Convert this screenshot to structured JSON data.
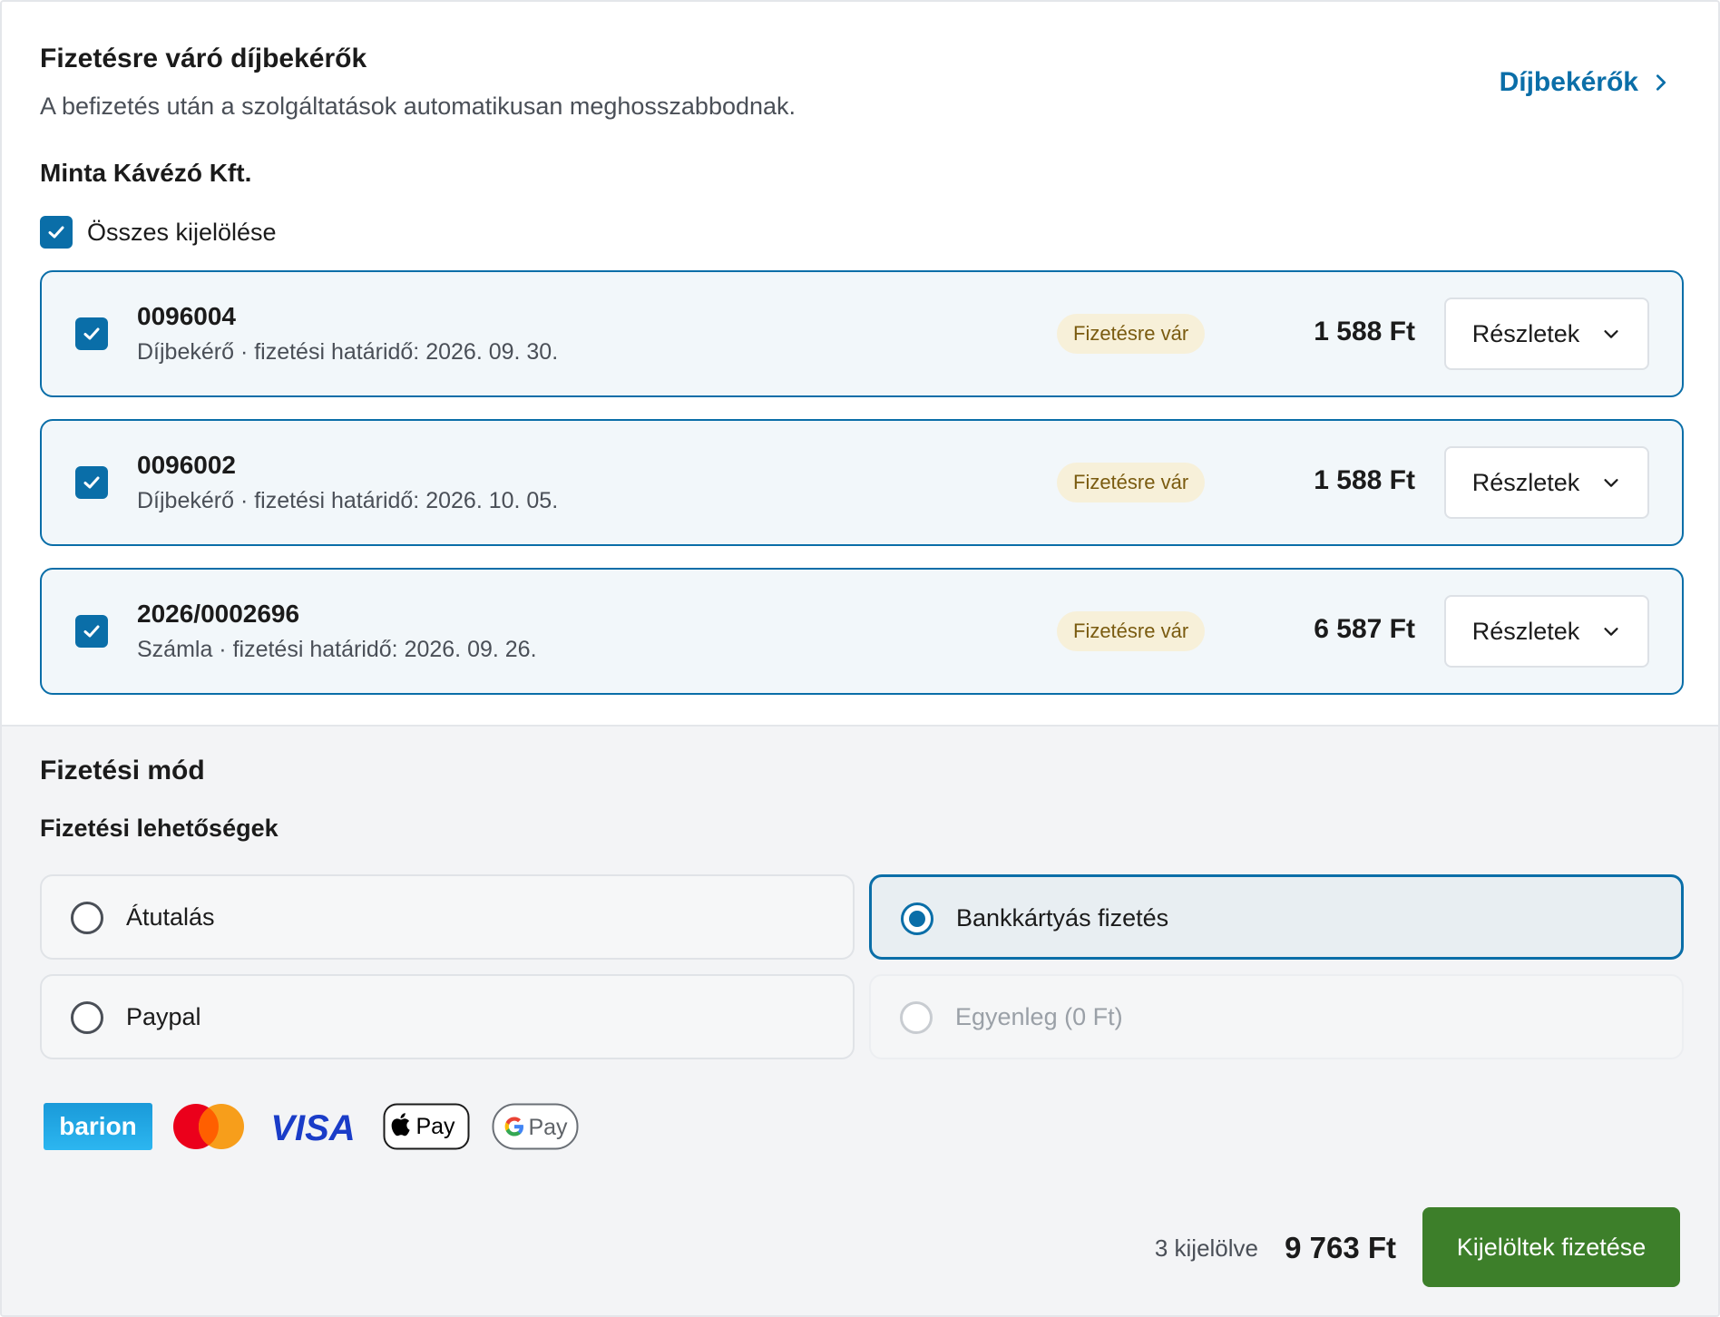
{
  "header": {
    "title": "Fizetésre váró díjbekérők",
    "subtitle": "A befizetés után a szolgáltatások automatikusan meghosszabbodnak.",
    "link_label": "Díjbekérők"
  },
  "company": "Minta Kávézó Kft.",
  "select_all": {
    "label": "Összes kijelölése",
    "checked": true
  },
  "items": [
    {
      "id": "0096004",
      "desc": "Díjbekérő · fizetési határidő: 2026. 09. 30.",
      "status": "Fizetésre vár",
      "amount": "1 588 Ft",
      "details_label": "Részletek",
      "checked": true
    },
    {
      "id": "0096002",
      "desc": "Díjbekérő · fizetési határidő: 2026. 10. 05.",
      "status": "Fizetésre vár",
      "amount": "1 588 Ft",
      "details_label": "Részletek",
      "checked": true
    },
    {
      "id": "2026/0002696",
      "desc": "Számla · fizetési határidő: 2026. 09. 26.",
      "status": "Fizetésre vár",
      "amount": "6 587 Ft",
      "details_label": "Részletek",
      "checked": true
    }
  ],
  "payment": {
    "title": "Fizetési mód",
    "subtitle": "Fizetési lehetőségek",
    "options": [
      {
        "label": "Átutalás",
        "selected": false,
        "disabled": false
      },
      {
        "label": "Bankkártyás fizetés",
        "selected": true,
        "disabled": false
      },
      {
        "label": "Paypal",
        "selected": false,
        "disabled": false
      },
      {
        "label": "Egyenleg (0 Ft)",
        "selected": false,
        "disabled": true
      }
    ],
    "logos": {
      "barion": "barion",
      "mastercard": "mastercard-logo",
      "visa": "VISA",
      "apple_pay": "Pay",
      "google_pay": "Pay"
    }
  },
  "footer": {
    "selected_count": "3 kijelölve",
    "total": "9 763 Ft",
    "pay_button": "Kijelöltek fizetése"
  },
  "colors": {
    "accent": "#0a6ea8",
    "badge_bg": "#f7f0d9",
    "badge_text": "#7a5b10",
    "pay_button": "#3d7f2a",
    "barion": "#1a9ad9",
    "mastercard_red": "#eb001b",
    "mastercard_orange": "#f79e1b",
    "visa": "#1a3cc8"
  }
}
